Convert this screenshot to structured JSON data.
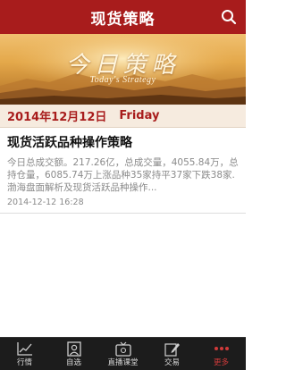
{
  "header": {
    "title": "现货策略"
  },
  "banner": {
    "title_cn": "今日策略",
    "title_en": "Today's Strategy"
  },
  "date_bar": {
    "date": "2014年12月12日",
    "weekday": "Friday"
  },
  "article": {
    "title": "现货活跃品种操作策略",
    "summary": "今日总成交额。217.26亿，总成交量，4055.84万，总持仓量，6085.74万上涨品种35家持平37家下跌38家.渤海盘面解析及现货活跃品种操作...",
    "date": "2014-12-12 16:28"
  },
  "tabbar": {
    "items": [
      {
        "label": "行情",
        "icon": "chart-icon"
      },
      {
        "label": "自选",
        "icon": "portrait-icon"
      },
      {
        "label": "直播课堂",
        "icon": "tv-icon"
      },
      {
        "label": "交易",
        "icon": "pen-icon"
      },
      {
        "label": "更多",
        "icon": "more-dots-icon"
      }
    ],
    "active_index": 4
  },
  "colors": {
    "header_bg": "#a81c1c",
    "accent": "#a81c1c",
    "tabbar_bg": "#1c1c1c",
    "active_tab": "#d23a3a"
  }
}
